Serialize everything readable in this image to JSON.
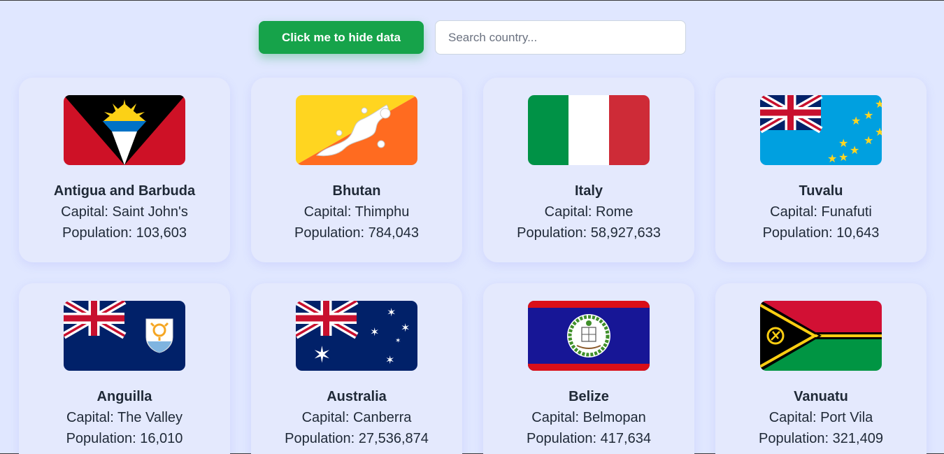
{
  "toolbar": {
    "toggle_label": "Click me to hide data",
    "search_placeholder": "Search country...",
    "search_value": ""
  },
  "labels": {
    "capital_prefix": "Capital: ",
    "population_prefix": "Population: "
  },
  "countries": [
    {
      "name": "Antigua and Barbuda",
      "capital": "Saint John's",
      "population": "103,603",
      "flag_icon": "antigua-and-barbuda-flag-icon"
    },
    {
      "name": "Bhutan",
      "capital": "Thimphu",
      "population": "784,043",
      "flag_icon": "bhutan-flag-icon"
    },
    {
      "name": "Italy",
      "capital": "Rome",
      "population": "58,927,633",
      "flag_icon": "italy-flag-icon"
    },
    {
      "name": "Tuvalu",
      "capital": "Funafuti",
      "population": "10,643",
      "flag_icon": "tuvalu-flag-icon"
    },
    {
      "name": "Anguilla",
      "capital": "The Valley",
      "population": "16,010",
      "flag_icon": "anguilla-flag-icon"
    },
    {
      "name": "Australia",
      "capital": "Canberra",
      "population": "27,536,874",
      "flag_icon": "australia-flag-icon"
    },
    {
      "name": "Belize",
      "capital": "Belmopan",
      "population": "417,634",
      "flag_icon": "belize-flag-icon"
    },
    {
      "name": "Vanuatu",
      "capital": "Port Vila",
      "population": "321,409",
      "flag_icon": "vanuatu-flag-icon"
    }
  ],
  "colors": {
    "accent": "#16a34a",
    "background": "#e0e7ff",
    "card": "#e4e9fd"
  }
}
